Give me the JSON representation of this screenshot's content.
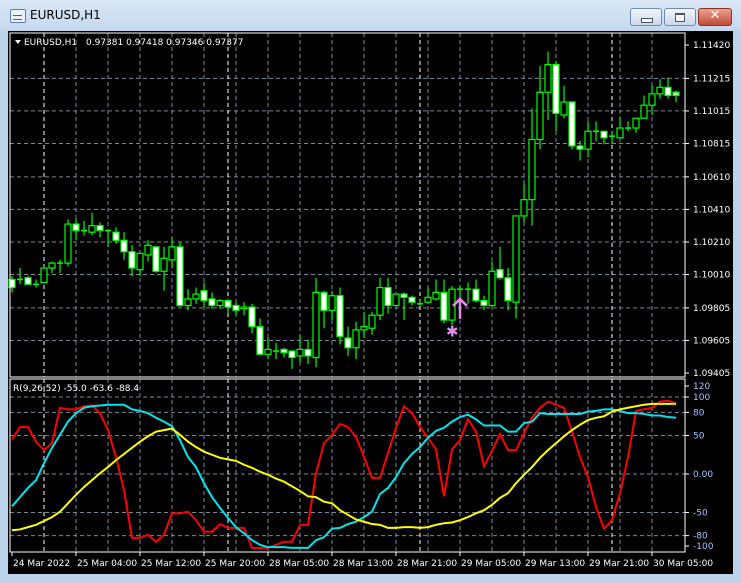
{
  "window": {
    "title": "EURUSD,H1",
    "buttons": {
      "minimize": "minimize",
      "maximize": "maximize",
      "close": "✕"
    }
  },
  "main_header": {
    "symbol": "EURUSD,H1",
    "ohlc": "0.97381 0.97418 0.97346 0.97377"
  },
  "indicator_header": "R(9,26,52) -55.0 -63.6 -88.4",
  "colors": {
    "background": "#000000",
    "candle_outline": "#00ff00",
    "bull_fill": "#000000",
    "bear_fill": "#ffffff",
    "grid": "#7b8797",
    "separator": "#ffffff",
    "series_red": "#ff0000",
    "series_cyan": "#00e5ee",
    "series_yellow": "#ffff00",
    "marker": "#e58ae6"
  },
  "chart_data": [
    {
      "type": "candlestick",
      "price_labels": [
        "1.11420",
        "1.11215",
        "1.11015",
        "1.10815",
        "1.10610",
        "1.10410",
        "1.10210",
        "1.10010",
        "1.09805",
        "1.09605",
        "1.09405"
      ],
      "ylim": [
        1.09405,
        1.1142
      ],
      "grid": true,
      "time_labels": [
        "24 Mar 2022",
        "25 Mar 04:00",
        "25 Mar 12:00",
        "25 Mar 20:00",
        "28 Mar 05:00",
        "28 Mar 13:00",
        "28 Mar 21:00",
        "29 Mar 05:00",
        "29 Mar 13:00",
        "29 Mar 21:00",
        "30 Mar 05:00"
      ],
      "separator_bars": [
        4,
        27,
        51,
        75
      ],
      "candles_ohlc": [
        [
          1.0998,
          1.1,
          1.099,
          1.0993
        ],
        [
          1.0998,
          1.1005,
          1.0995,
          1.0998
        ],
        [
          1.0999,
          1.1,
          1.0995,
          1.0995
        ],
        [
          1.0995,
          1.0998,
          1.0993,
          1.0995
        ],
        [
          1.0996,
          1.1006,
          1.0996,
          1.1005
        ],
        [
          1.1005,
          1.1009,
          1.1002,
          1.1008
        ],
        [
          1.1008,
          1.101,
          1.1002,
          1.1008
        ],
        [
          1.1008,
          1.1035,
          1.1006,
          1.1032
        ],
        [
          1.1032,
          1.1035,
          1.1022,
          1.1028
        ],
        [
          1.1028,
          1.1034,
          1.1025,
          1.1028
        ],
        [
          1.1027,
          1.1039,
          1.1025,
          1.1031
        ],
        [
          1.1031,
          1.1033,
          1.1024,
          1.1028
        ],
        [
          1.1028,
          1.1028,
          1.1018,
          1.1028
        ],
        [
          1.1027,
          1.103,
          1.102,
          1.1022
        ],
        [
          1.1022,
          1.1027,
          1.101,
          1.1015
        ],
        [
          1.1015,
          1.1019,
          1.1,
          1.1005
        ],
        [
          1.1004,
          1.1014,
          1.1,
          1.1014
        ],
        [
          1.1013,
          1.1022,
          1.1009,
          1.1019
        ],
        [
          1.1018,
          1.1018,
          1.1002,
          1.1003
        ],
        [
          1.1003,
          1.1018,
          1.0991,
          1.1011
        ],
        [
          1.101,
          1.1024,
          1.1005,
          1.1018
        ],
        [
          1.1018,
          1.1021,
          1.0981,
          1.0982
        ],
        [
          1.0982,
          1.0992,
          1.0979,
          1.0986
        ],
        [
          1.0986,
          1.0993,
          1.0983,
          1.0989
        ],
        [
          1.0991,
          1.0996,
          1.0981,
          1.0985
        ],
        [
          1.0986,
          1.099,
          1.098,
          1.0982
        ],
        [
          1.0982,
          1.0986,
          1.098,
          1.0985
        ],
        [
          1.0985,
          1.0986,
          1.0977,
          1.0981
        ],
        [
          1.0982,
          1.0984,
          1.0976,
          1.0979
        ],
        [
          1.098,
          1.0984,
          1.0976,
          1.0981
        ],
        [
          1.0981,
          1.0983,
          1.0965,
          1.0969
        ],
        [
          1.0969,
          1.0974,
          1.0952,
          1.0952
        ],
        [
          1.0952,
          1.0962,
          1.0949,
          1.0955
        ],
        [
          1.0954,
          1.0959,
          1.0949,
          1.0954
        ],
        [
          1.0955,
          1.0956,
          1.095,
          1.0953
        ],
        [
          1.0954,
          1.0954,
          1.0943,
          1.095
        ],
        [
          1.0951,
          1.0964,
          1.0947,
          1.0955
        ],
        [
          1.0955,
          1.0961,
          1.0946,
          1.0951
        ],
        [
          1.095,
          1.0999,
          1.0944,
          1.099
        ],
        [
          1.099,
          1.0991,
          1.0968,
          1.0979
        ],
        [
          1.0979,
          1.0991,
          1.0973,
          1.0988
        ],
        [
          1.0988,
          1.0993,
          1.0958,
          1.0963
        ],
        [
          1.0962,
          1.0969,
          1.0951,
          1.0956
        ],
        [
          1.0956,
          1.0972,
          1.0949,
          1.0967
        ],
        [
          1.0967,
          1.0978,
          1.0962,
          1.0969
        ],
        [
          1.0968,
          1.0978,
          1.0964,
          1.0976
        ],
        [
          1.0976,
          1.0999,
          1.0973,
          1.0993
        ],
        [
          1.0993,
          1.0999,
          1.0977,
          1.0982
        ],
        [
          1.0982,
          1.0989,
          1.0982,
          1.0989
        ],
        [
          1.0989,
          1.099,
          1.0973,
          1.0987
        ],
        [
          1.0987,
          1.0988,
          1.0982,
          1.0984
        ],
        [
          1.0983,
          1.0985,
          1.0982,
          1.0983
        ],
        [
          1.0984,
          1.0993,
          1.0983,
          1.0987
        ],
        [
          1.0986,
          1.0998,
          1.0985,
          1.099
        ],
        [
          1.099,
          1.0998,
          1.0971,
          1.0973
        ],
        [
          1.0973,
          1.0994,
          1.097,
          1.0992
        ],
        [
          1.0992,
          1.0994,
          1.0986,
          1.0992
        ],
        [
          1.0992,
          1.0996,
          1.0983,
          1.0992
        ],
        [
          1.0992,
          1.0998,
          1.0984,
          1.0985
        ],
        [
          1.0985,
          1.0988,
          1.0979,
          1.0982
        ],
        [
          1.0982,
          1.1009,
          1.0981,
          1.1003
        ],
        [
          1.1004,
          1.1018,
          1.0998,
          1.0999
        ],
        [
          1.0999,
          1.1005,
          1.0979,
          1.0985
        ],
        [
          1.0984,
          1.1037,
          1.0974,
          1.1037
        ],
        [
          1.1037,
          1.1057,
          1.1033,
          1.1047
        ],
        [
          1.1047,
          1.1103,
          1.1031,
          1.1084
        ],
        [
          1.1084,
          1.1129,
          1.1078,
          1.1113
        ],
        [
          1.1113,
          1.1138,
          1.1096,
          1.113
        ],
        [
          1.113,
          1.1132,
          1.1089,
          1.11
        ],
        [
          1.1099,
          1.1117,
          1.1097,
          1.1107
        ],
        [
          1.1107,
          1.1107,
          1.1078,
          1.108
        ],
        [
          1.108,
          1.1083,
          1.1071,
          1.1078
        ],
        [
          1.1078,
          1.1095,
          1.1073,
          1.1089
        ],
        [
          1.1089,
          1.1095,
          1.1083,
          1.1089
        ],
        [
          1.1089,
          1.1089,
          1.1081,
          1.1085
        ],
        [
          1.1086,
          1.1089,
          1.1081,
          1.1086
        ],
        [
          1.1085,
          1.1098,
          1.1085,
          1.1091
        ],
        [
          1.1091,
          1.1095,
          1.1089,
          1.1091
        ],
        [
          1.1091,
          1.1097,
          1.1088,
          1.1097
        ],
        [
          1.1097,
          1.1111,
          1.1097,
          1.1105
        ],
        [
          1.1105,
          1.1117,
          1.1099,
          1.1112
        ],
        [
          1.1112,
          1.1121,
          1.1109,
          1.1116
        ],
        [
          1.1116,
          1.1122,
          1.1109,
          1.1111
        ],
        [
          1.1113,
          1.1114,
          1.1107,
          1.1111
        ]
      ],
      "markers": [
        {
          "type": "arrow-up",
          "bar": 56,
          "price": 1.0986
        },
        {
          "type": "star",
          "bar": 55,
          "price": 1.0966
        }
      ]
    },
    {
      "type": "line",
      "tick_labels": [
        "120",
        "100",
        "80",
        "50",
        "0.00",
        "-50",
        "-80",
        "-100"
      ],
      "tick_values": [
        120,
        100,
        80,
        50,
        0,
        -50,
        -80,
        -100
      ],
      "grid_values": [
        100,
        80,
        50,
        0,
        -50,
        -80
      ],
      "ylim": [
        -100,
        120
      ],
      "series": [
        {
          "color": "#ff0000",
          "values": [
            45,
            61,
            61,
            42,
            31,
            40,
            86,
            84,
            84,
            88,
            89,
            79,
            57,
            22,
            -21,
            -83,
            -83,
            -79,
            -88,
            -79,
            -51,
            -51,
            -49,
            -60,
            -75,
            -75,
            -65,
            -70,
            -70,
            -70,
            -96,
            -96,
            -96,
            -92,
            -88,
            -88,
            -66,
            -66,
            1,
            40,
            51,
            65,
            61,
            48,
            22,
            -5,
            -5,
            27,
            60,
            88,
            79,
            61,
            47,
            32,
            -29,
            32,
            44,
            71,
            55,
            10,
            30,
            52,
            31,
            31,
            53,
            73,
            86,
            94,
            90,
            86,
            55,
            22,
            -4,
            -43,
            -71,
            -60,
            -25,
            22,
            82,
            84,
            86,
            94,
            95,
            92
          ]
        },
        {
          "color": "#00e5ee",
          "values": [
            -42,
            -30,
            -18,
            -8,
            14,
            34,
            51,
            68,
            79,
            86,
            88,
            89,
            90,
            90,
            90,
            84,
            82,
            79,
            73,
            68,
            62,
            44,
            22,
            9,
            -12,
            -30,
            -44,
            -57,
            -69,
            -77,
            -86,
            -92,
            -95,
            -95,
            -95,
            -96,
            -96,
            -96,
            -86,
            -82,
            -71,
            -70,
            -65,
            -62,
            -56,
            -49,
            -26,
            -18,
            -4,
            14,
            26,
            35,
            47,
            56,
            60,
            68,
            74,
            77,
            71,
            63,
            63,
            63,
            55,
            55,
            66,
            68,
            79,
            78,
            78,
            78,
            78,
            78,
            81,
            82,
            84,
            84,
            82,
            79,
            79,
            78,
            76,
            76,
            74,
            73
          ]
        },
        {
          "color": "#ffff00",
          "values": [
            -73,
            -72,
            -69,
            -66,
            -61,
            -56,
            -49,
            -38,
            -27,
            -17,
            -8,
            1,
            9,
            18,
            26,
            34,
            42,
            49,
            55,
            57,
            59,
            51,
            42,
            35,
            29,
            25,
            21,
            19,
            17,
            12,
            8,
            3,
            -1,
            -6,
            -10,
            -16,
            -22,
            -29,
            -30,
            -36,
            -38,
            -47,
            -53,
            -59,
            -62,
            -65,
            -66,
            -70,
            -70,
            -69,
            -69,
            -70,
            -69,
            -66,
            -64,
            -63,
            -60,
            -56,
            -51,
            -47,
            -40,
            -31,
            -25,
            -12,
            -1,
            9,
            21,
            31,
            40,
            49,
            57,
            64,
            70,
            73,
            75,
            81,
            84,
            86,
            88,
            90,
            91,
            91,
            91,
            91
          ]
        }
      ]
    }
  ]
}
